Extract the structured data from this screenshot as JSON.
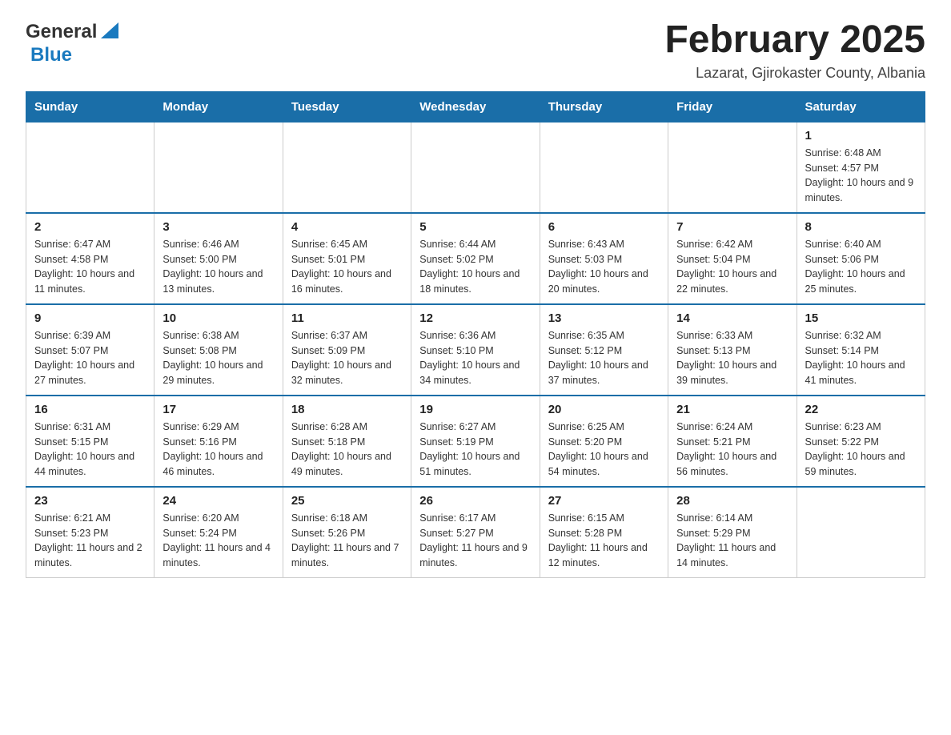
{
  "logo": {
    "text_general": "General",
    "text_blue": "Blue"
  },
  "title": {
    "month_year": "February 2025",
    "location": "Lazarat, Gjirokaster County, Albania"
  },
  "weekdays": [
    "Sunday",
    "Monday",
    "Tuesday",
    "Wednesday",
    "Thursday",
    "Friday",
    "Saturday"
  ],
  "weeks": [
    [
      {
        "day": "",
        "sunrise": "",
        "sunset": "",
        "daylight": "",
        "empty": true
      },
      {
        "day": "",
        "sunrise": "",
        "sunset": "",
        "daylight": "",
        "empty": true
      },
      {
        "day": "",
        "sunrise": "",
        "sunset": "",
        "daylight": "",
        "empty": true
      },
      {
        "day": "",
        "sunrise": "",
        "sunset": "",
        "daylight": "",
        "empty": true
      },
      {
        "day": "",
        "sunrise": "",
        "sunset": "",
        "daylight": "",
        "empty": true
      },
      {
        "day": "",
        "sunrise": "",
        "sunset": "",
        "daylight": "",
        "empty": true
      },
      {
        "day": "1",
        "sunrise": "Sunrise: 6:48 AM",
        "sunset": "Sunset: 4:57 PM",
        "daylight": "Daylight: 10 hours and 9 minutes.",
        "empty": false
      }
    ],
    [
      {
        "day": "2",
        "sunrise": "Sunrise: 6:47 AM",
        "sunset": "Sunset: 4:58 PM",
        "daylight": "Daylight: 10 hours and 11 minutes.",
        "empty": false
      },
      {
        "day": "3",
        "sunrise": "Sunrise: 6:46 AM",
        "sunset": "Sunset: 5:00 PM",
        "daylight": "Daylight: 10 hours and 13 minutes.",
        "empty": false
      },
      {
        "day": "4",
        "sunrise": "Sunrise: 6:45 AM",
        "sunset": "Sunset: 5:01 PM",
        "daylight": "Daylight: 10 hours and 16 minutes.",
        "empty": false
      },
      {
        "day": "5",
        "sunrise": "Sunrise: 6:44 AM",
        "sunset": "Sunset: 5:02 PM",
        "daylight": "Daylight: 10 hours and 18 minutes.",
        "empty": false
      },
      {
        "day": "6",
        "sunrise": "Sunrise: 6:43 AM",
        "sunset": "Sunset: 5:03 PM",
        "daylight": "Daylight: 10 hours and 20 minutes.",
        "empty": false
      },
      {
        "day": "7",
        "sunrise": "Sunrise: 6:42 AM",
        "sunset": "Sunset: 5:04 PM",
        "daylight": "Daylight: 10 hours and 22 minutes.",
        "empty": false
      },
      {
        "day": "8",
        "sunrise": "Sunrise: 6:40 AM",
        "sunset": "Sunset: 5:06 PM",
        "daylight": "Daylight: 10 hours and 25 minutes.",
        "empty": false
      }
    ],
    [
      {
        "day": "9",
        "sunrise": "Sunrise: 6:39 AM",
        "sunset": "Sunset: 5:07 PM",
        "daylight": "Daylight: 10 hours and 27 minutes.",
        "empty": false
      },
      {
        "day": "10",
        "sunrise": "Sunrise: 6:38 AM",
        "sunset": "Sunset: 5:08 PM",
        "daylight": "Daylight: 10 hours and 29 minutes.",
        "empty": false
      },
      {
        "day": "11",
        "sunrise": "Sunrise: 6:37 AM",
        "sunset": "Sunset: 5:09 PM",
        "daylight": "Daylight: 10 hours and 32 minutes.",
        "empty": false
      },
      {
        "day": "12",
        "sunrise": "Sunrise: 6:36 AM",
        "sunset": "Sunset: 5:10 PM",
        "daylight": "Daylight: 10 hours and 34 minutes.",
        "empty": false
      },
      {
        "day": "13",
        "sunrise": "Sunrise: 6:35 AM",
        "sunset": "Sunset: 5:12 PM",
        "daylight": "Daylight: 10 hours and 37 minutes.",
        "empty": false
      },
      {
        "day": "14",
        "sunrise": "Sunrise: 6:33 AM",
        "sunset": "Sunset: 5:13 PM",
        "daylight": "Daylight: 10 hours and 39 minutes.",
        "empty": false
      },
      {
        "day": "15",
        "sunrise": "Sunrise: 6:32 AM",
        "sunset": "Sunset: 5:14 PM",
        "daylight": "Daylight: 10 hours and 41 minutes.",
        "empty": false
      }
    ],
    [
      {
        "day": "16",
        "sunrise": "Sunrise: 6:31 AM",
        "sunset": "Sunset: 5:15 PM",
        "daylight": "Daylight: 10 hours and 44 minutes.",
        "empty": false
      },
      {
        "day": "17",
        "sunrise": "Sunrise: 6:29 AM",
        "sunset": "Sunset: 5:16 PM",
        "daylight": "Daylight: 10 hours and 46 minutes.",
        "empty": false
      },
      {
        "day": "18",
        "sunrise": "Sunrise: 6:28 AM",
        "sunset": "Sunset: 5:18 PM",
        "daylight": "Daylight: 10 hours and 49 minutes.",
        "empty": false
      },
      {
        "day": "19",
        "sunrise": "Sunrise: 6:27 AM",
        "sunset": "Sunset: 5:19 PM",
        "daylight": "Daylight: 10 hours and 51 minutes.",
        "empty": false
      },
      {
        "day": "20",
        "sunrise": "Sunrise: 6:25 AM",
        "sunset": "Sunset: 5:20 PM",
        "daylight": "Daylight: 10 hours and 54 minutes.",
        "empty": false
      },
      {
        "day": "21",
        "sunrise": "Sunrise: 6:24 AM",
        "sunset": "Sunset: 5:21 PM",
        "daylight": "Daylight: 10 hours and 56 minutes.",
        "empty": false
      },
      {
        "day": "22",
        "sunrise": "Sunrise: 6:23 AM",
        "sunset": "Sunset: 5:22 PM",
        "daylight": "Daylight: 10 hours and 59 minutes.",
        "empty": false
      }
    ],
    [
      {
        "day": "23",
        "sunrise": "Sunrise: 6:21 AM",
        "sunset": "Sunset: 5:23 PM",
        "daylight": "Daylight: 11 hours and 2 minutes.",
        "empty": false
      },
      {
        "day": "24",
        "sunrise": "Sunrise: 6:20 AM",
        "sunset": "Sunset: 5:24 PM",
        "daylight": "Daylight: 11 hours and 4 minutes.",
        "empty": false
      },
      {
        "day": "25",
        "sunrise": "Sunrise: 6:18 AM",
        "sunset": "Sunset: 5:26 PM",
        "daylight": "Daylight: 11 hours and 7 minutes.",
        "empty": false
      },
      {
        "day": "26",
        "sunrise": "Sunrise: 6:17 AM",
        "sunset": "Sunset: 5:27 PM",
        "daylight": "Daylight: 11 hours and 9 minutes.",
        "empty": false
      },
      {
        "day": "27",
        "sunrise": "Sunrise: 6:15 AM",
        "sunset": "Sunset: 5:28 PM",
        "daylight": "Daylight: 11 hours and 12 minutes.",
        "empty": false
      },
      {
        "day": "28",
        "sunrise": "Sunrise: 6:14 AM",
        "sunset": "Sunset: 5:29 PM",
        "daylight": "Daylight: 11 hours and 14 minutes.",
        "empty": false
      },
      {
        "day": "",
        "sunrise": "",
        "sunset": "",
        "daylight": "",
        "empty": true
      }
    ]
  ]
}
